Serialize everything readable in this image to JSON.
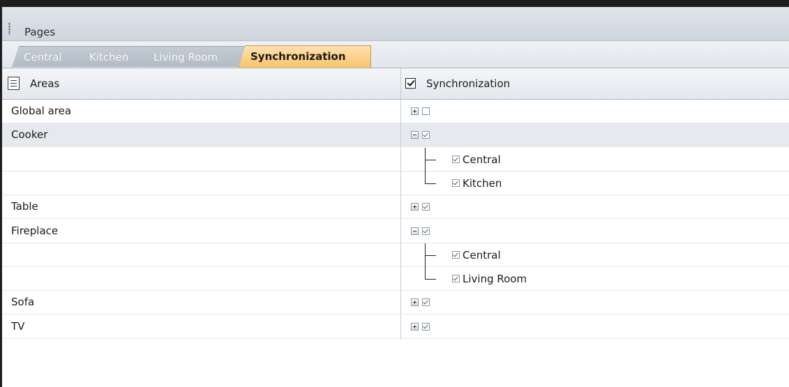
{
  "panel": {
    "title": "Pages"
  },
  "tabs": [
    {
      "label": "Central",
      "active": false
    },
    {
      "label": "Kitchen",
      "active": false
    },
    {
      "label": "Living Room",
      "active": false
    },
    {
      "label": "Synchronization",
      "active": true
    }
  ],
  "grid": {
    "columns": {
      "areas": "Areas",
      "sync": "Synchronization"
    },
    "header_sync_checked": true,
    "rows": [
      {
        "area": "Global area",
        "expander": "plus",
        "checked": false
      },
      {
        "area": "Cooker",
        "expander": "minus",
        "checked": true,
        "selected": true
      },
      {
        "child": "Central",
        "checked": true
      },
      {
        "child": "Kitchen",
        "checked": true
      },
      {
        "area": "Table",
        "expander": "plus",
        "checked": true
      },
      {
        "area": "Fireplace",
        "expander": "minus",
        "checked": true
      },
      {
        "child": "Central",
        "checked": true
      },
      {
        "child": "Living Room",
        "checked": true
      },
      {
        "area": "Sofa",
        "expander": "plus",
        "checked": true
      },
      {
        "area": "TV",
        "expander": "plus",
        "checked": true
      }
    ]
  },
  "colors": {
    "active_tab": "#f9c36b",
    "inactive_tab": "#b3bcc6",
    "selected_row": "#e6eaee"
  }
}
